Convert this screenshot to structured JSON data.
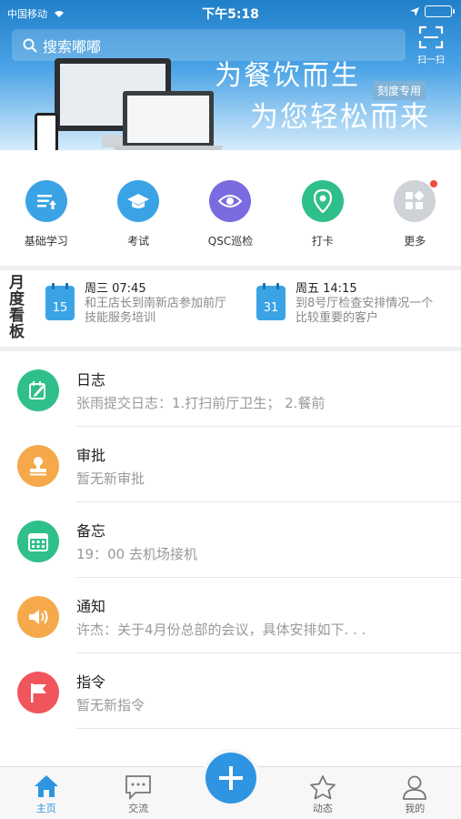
{
  "status_bar": {
    "carrier": "中国移动",
    "time": "下午5:18"
  },
  "header": {
    "search_placeholder": "搜索嘟嘟",
    "scan_label": "扫一扫",
    "tagline_1": "为餐饮而生",
    "tagline_2": "为您轻松而来",
    "badge": "刻度专用"
  },
  "quick_actions": [
    {
      "label": "基础学习",
      "icon": "learning-icon",
      "color": "#3aa3e6"
    },
    {
      "label": "考试",
      "icon": "graduation-cap-icon",
      "color": "#3aa3e6"
    },
    {
      "label": "QSC巡检",
      "icon": "eye-icon",
      "color": "#7a6be0"
    },
    {
      "label": "打卡",
      "icon": "location-pin-icon",
      "color": "#2fbf8a"
    },
    {
      "label": "更多",
      "icon": "more-grid-icon",
      "color": "#cfd3d8"
    }
  ],
  "board": {
    "title": "月度看板",
    "items": [
      {
        "day_num": "15",
        "time": "周三 07:45",
        "text": "和王店长到南新店参加前厅技能服务培训"
      },
      {
        "day_num": "31",
        "time": "周五 14:15",
        "text": "到8号厅检查安排情况一个比较重要的客户"
      }
    ]
  },
  "list": [
    {
      "title": "日志",
      "subtitle": "张雨提交日志：1.打扫前厅卫生； 2.餐前",
      "color": "#2fbf8a",
      "icon": "edit-note-icon"
    },
    {
      "title": "审批",
      "subtitle": "暂无新审批",
      "color": "#f5a94a",
      "icon": "stamp-icon"
    },
    {
      "title": "备忘",
      "subtitle": "19：00  去机场接机",
      "color": "#2fbf8a",
      "icon": "calendar-icon"
    },
    {
      "title": "通知",
      "subtitle": "许杰：关于4月份总部的会议，具体安排如下. . .",
      "color": "#f5a94a",
      "icon": "speaker-icon"
    },
    {
      "title": "指令",
      "subtitle": "暂无新指令",
      "color": "#f0555c",
      "icon": "flag-icon"
    }
  ],
  "tabbar": [
    {
      "label": "主页",
      "icon": "home-icon",
      "active": true
    },
    {
      "label": "交流",
      "icon": "chat-icon",
      "active": false
    },
    {
      "label": "",
      "icon": "plus-icon",
      "active": false
    },
    {
      "label": "动态",
      "icon": "star-icon",
      "active": false
    },
    {
      "label": "我的",
      "icon": "user-icon",
      "active": false
    }
  ],
  "accent_color": "#2f95e2"
}
